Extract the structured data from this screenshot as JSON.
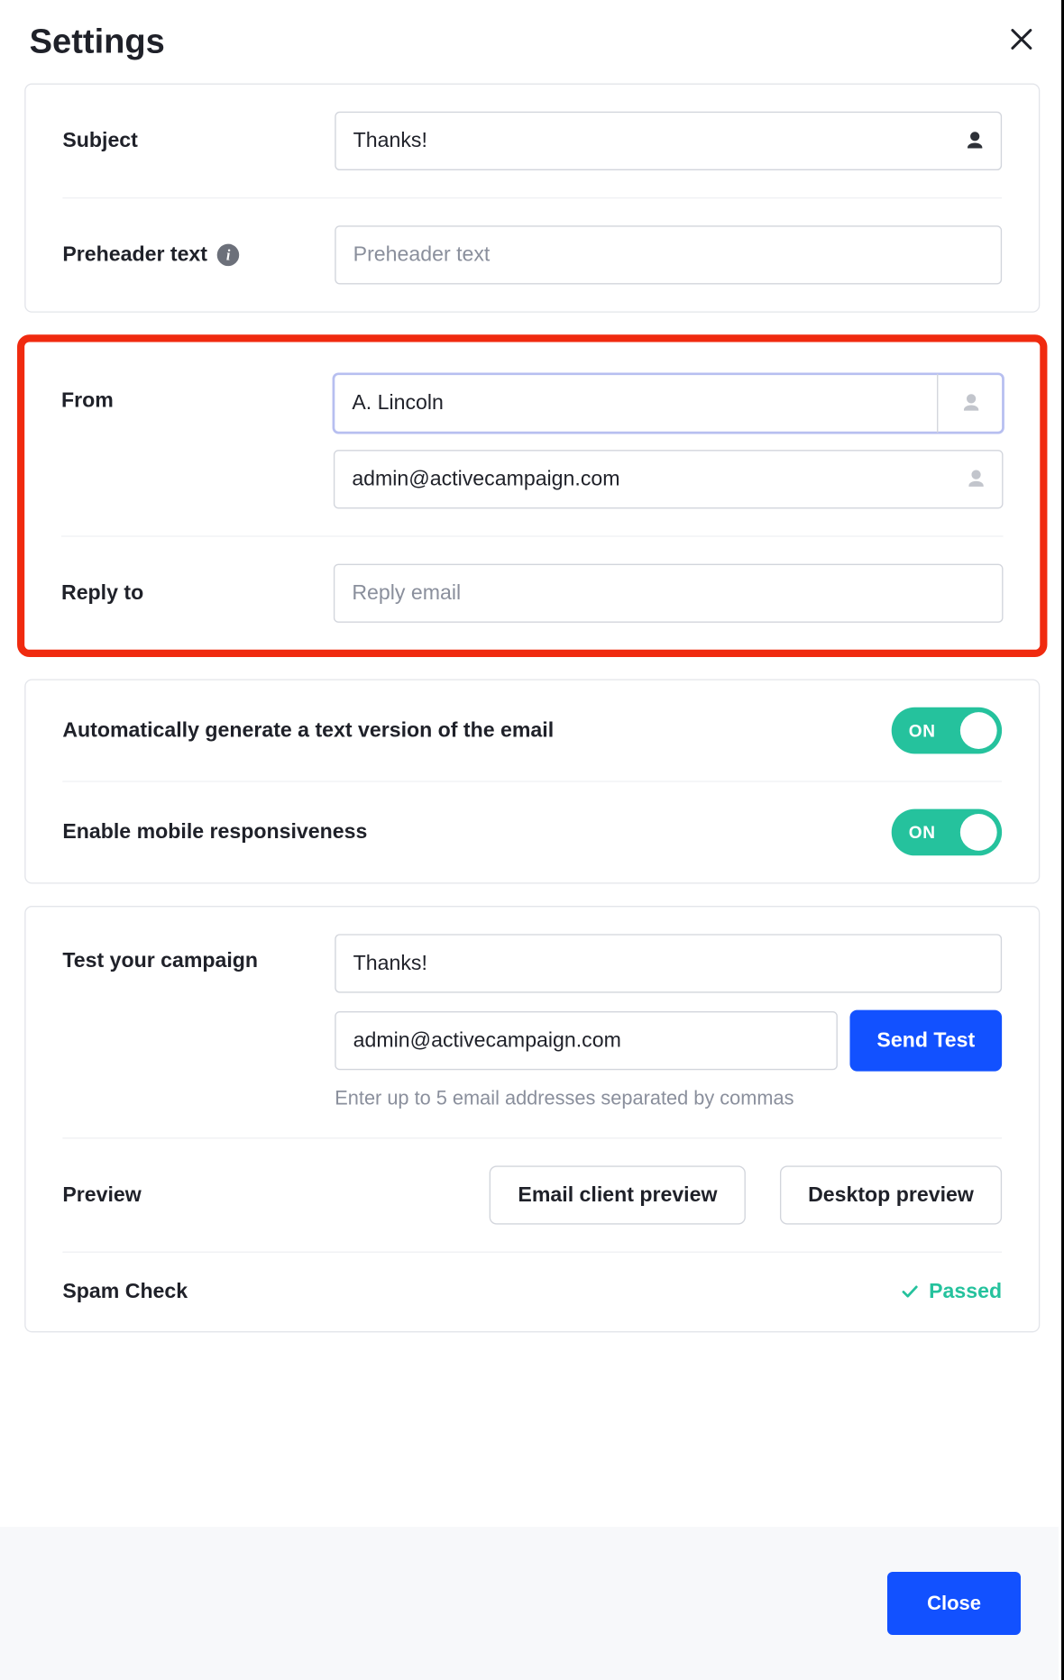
{
  "header": {
    "title": "Settings"
  },
  "subject": {
    "label": "Subject",
    "value": "Thanks!"
  },
  "preheader": {
    "label": "Preheader text",
    "placeholder": "Preheader text"
  },
  "from": {
    "label": "From",
    "name_value": "A. Lincoln",
    "email_value": "admin@activecampaign.com"
  },
  "reply_to": {
    "label": "Reply to",
    "placeholder": "Reply email"
  },
  "toggles": {
    "auto_text": {
      "label": "Automatically generate a text version of the email",
      "state": "ON"
    },
    "responsive": {
      "label": "Enable mobile responsiveness",
      "state": "ON"
    }
  },
  "test": {
    "label": "Test your campaign",
    "subject_value": "Thanks!",
    "email_value": "admin@activecampaign.com",
    "send_button": "Send Test",
    "helper": "Enter up to 5 email addresses separated by commas"
  },
  "preview": {
    "label": "Preview",
    "client_btn": "Email client preview",
    "desktop_btn": "Desktop preview"
  },
  "spam": {
    "label": "Spam Check",
    "status": "Passed"
  },
  "footer": {
    "close": "Close"
  }
}
